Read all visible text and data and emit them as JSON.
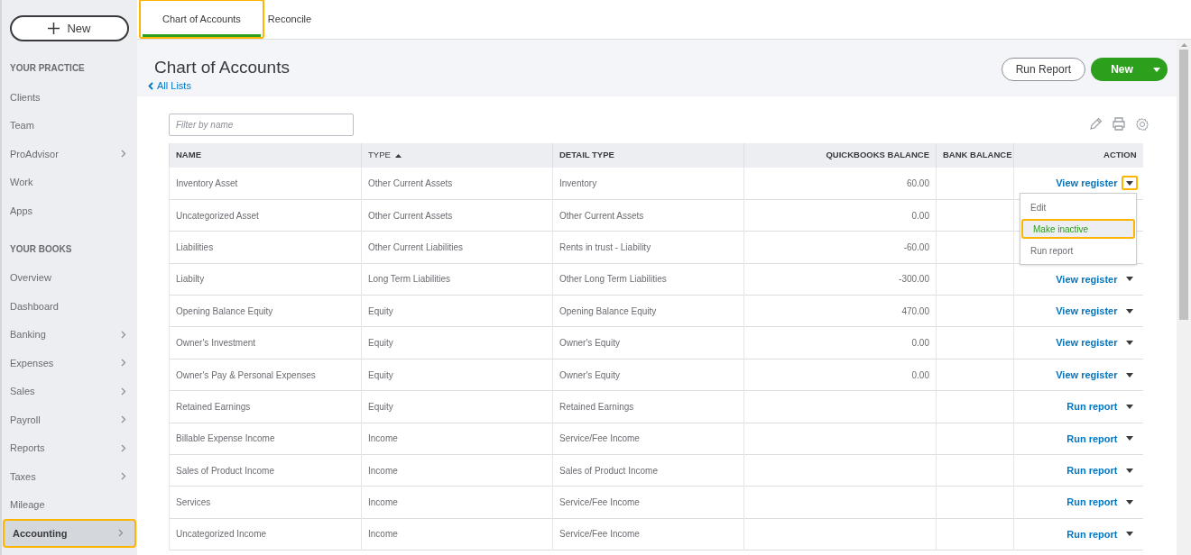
{
  "new_button": {
    "label": "New",
    "highlighted": false
  },
  "sidebar": {
    "sections": [
      {
        "heading": "YOUR PRACTICE",
        "items": [
          {
            "label": "Clients",
            "has_submenu": false,
            "selected": false,
            "highlighted": false
          },
          {
            "label": "Team",
            "has_submenu": false,
            "selected": false,
            "highlighted": false
          },
          {
            "label": "ProAdvisor",
            "has_submenu": true,
            "selected": false,
            "highlighted": false
          },
          {
            "label": "Work",
            "has_submenu": false,
            "selected": false,
            "highlighted": false
          },
          {
            "label": "Apps",
            "has_submenu": false,
            "selected": false,
            "highlighted": false
          }
        ]
      },
      {
        "heading": "YOUR BOOKS",
        "items": [
          {
            "label": "Overview",
            "has_submenu": false,
            "selected": false,
            "highlighted": false
          },
          {
            "label": "Dashboard",
            "has_submenu": false,
            "selected": false,
            "highlighted": false
          },
          {
            "label": "Banking",
            "has_submenu": true,
            "selected": false,
            "highlighted": false
          },
          {
            "label": "Expenses",
            "has_submenu": true,
            "selected": false,
            "highlighted": false
          },
          {
            "label": "Sales",
            "has_submenu": true,
            "selected": false,
            "highlighted": false
          },
          {
            "label": "Payroll",
            "has_submenu": true,
            "selected": false,
            "highlighted": false
          },
          {
            "label": "Reports",
            "has_submenu": true,
            "selected": false,
            "highlighted": false
          },
          {
            "label": "Taxes",
            "has_submenu": true,
            "selected": false,
            "highlighted": false
          },
          {
            "label": "Mileage",
            "has_submenu": false,
            "selected": false,
            "highlighted": false
          },
          {
            "label": "Accounting",
            "has_submenu": true,
            "selected": true,
            "highlighted": true
          }
        ]
      }
    ]
  },
  "tabs": [
    {
      "label": "Chart of Accounts",
      "selected": true,
      "highlighted": true
    },
    {
      "label": "Reconcile",
      "selected": false,
      "highlighted": false
    }
  ],
  "page": {
    "title": "Chart of Accounts",
    "back_link": "All Lists",
    "run_report_button": "Run Report",
    "new_button": "New"
  },
  "filter": {
    "placeholder": "Filter by name"
  },
  "table": {
    "columns": [
      {
        "label": "NAME",
        "sorted": false
      },
      {
        "label": "TYPE",
        "sorted": true
      },
      {
        "label": "DETAIL TYPE",
        "sorted": false
      },
      {
        "label": "QUICKBOOKS BALANCE",
        "sorted": false
      },
      {
        "label": "BANK BALANCE",
        "sorted": false
      },
      {
        "label": "ACTION",
        "sorted": false
      }
    ],
    "rows": [
      {
        "name": "Inventory Asset",
        "type": "Other Current Assets",
        "detail_type": "Inventory",
        "quickbooks_balance": "60.00",
        "action": "View register",
        "menu_open": true
      },
      {
        "name": "Uncategorized Asset",
        "type": "Other Current Assets",
        "detail_type": "Other Current Assets",
        "quickbooks_balance": "0.00",
        "menu_open": false
      },
      {
        "name": "Liabilities",
        "type": "Other Current Liabilities",
        "detail_type": "Rents in trust - Liability",
        "quickbooks_balance": "-60.00",
        "menu_open": false
      },
      {
        "name": "Liabilty",
        "type": "Long Term Liabilities",
        "detail_type": "Other Long Term Liabilities",
        "quickbooks_balance": "-300.00",
        "action": "View register",
        "menu_open": false
      },
      {
        "name": "Opening Balance Equity",
        "type": "Equity",
        "detail_type": "Opening Balance Equity",
        "quickbooks_balance": "470.00",
        "action": "View register",
        "menu_open": false
      },
      {
        "name": "Owner's Investment",
        "type": "Equity",
        "detail_type": "Owner's Equity",
        "quickbooks_balance": "0.00",
        "action": "View register",
        "menu_open": false
      },
      {
        "name": "Owner's Pay & Personal Expenses",
        "type": "Equity",
        "detail_type": "Owner's Equity",
        "quickbooks_balance": "0.00",
        "action": "View register",
        "menu_open": false
      },
      {
        "name": "Retained Earnings",
        "type": "Equity",
        "detail_type": "Retained Earnings",
        "action": "Run report",
        "menu_open": false
      },
      {
        "name": "Billable Expense Income",
        "type": "Income",
        "detail_type": "Service/Fee Income",
        "action": "Run report",
        "menu_open": false
      },
      {
        "name": "Sales of Product Income",
        "type": "Income",
        "detail_type": "Sales of Product Income",
        "action": "Run report",
        "menu_open": false
      },
      {
        "name": "Services",
        "type": "Income",
        "detail_type": "Service/Fee Income",
        "action": "Run report",
        "menu_open": false
      },
      {
        "name": "Uncategorized Income",
        "type": "Income",
        "detail_type": "Service/Fee Income",
        "action": "Run report",
        "menu_open": false
      }
    ]
  },
  "action_menu": {
    "items": [
      {
        "label": "Edit",
        "highlighted": false
      },
      {
        "label": "Make inactive",
        "highlighted": true
      },
      {
        "label": "Run report",
        "highlighted": false
      }
    ]
  }
}
